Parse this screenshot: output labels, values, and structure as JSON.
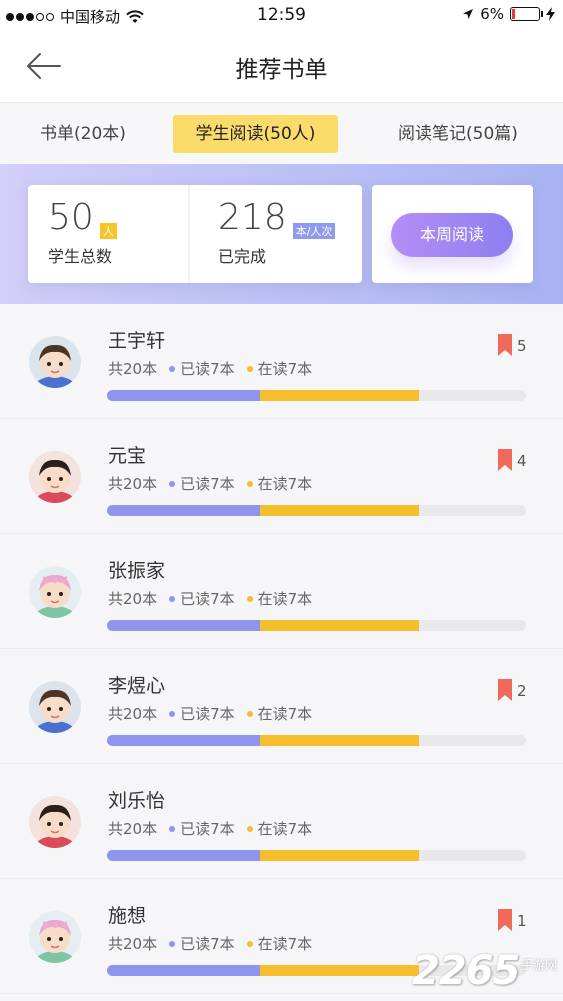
{
  "status_bar": {
    "carrier": "中国移动",
    "time": "12:59",
    "battery": "6%"
  },
  "nav": {
    "title": "推荐书单"
  },
  "tabs": [
    {
      "label": "书单(20本)"
    },
    {
      "label": "学生阅读(50人)"
    },
    {
      "label": "阅读笔记(50篇)"
    }
  ],
  "summary": {
    "students": {
      "value": "50",
      "unit": "人",
      "label": "学生总数"
    },
    "completed": {
      "value": "218",
      "unit": "本/人次",
      "label": "已完成"
    },
    "week_button": "本周阅读"
  },
  "students": [
    {
      "name": "王宇轩",
      "total": "共20本",
      "read": "已读7本",
      "reading": "在读7本",
      "read_fraction": 0.365,
      "reading_fraction": 0.38,
      "bookmarks": "5"
    },
    {
      "name": "元宝",
      "total": "共20本",
      "read": "已读7本",
      "reading": "在读7本",
      "read_fraction": 0.365,
      "reading_fraction": 0.38,
      "bookmarks": "4"
    },
    {
      "name": "张振家",
      "total": "共20本",
      "read": "已读7本",
      "reading": "在读7本",
      "read_fraction": 0.365,
      "reading_fraction": 0.38,
      "bookmarks": ""
    },
    {
      "name": "李煜心",
      "total": "共20本",
      "read": "已读7本",
      "reading": "在读7本",
      "read_fraction": 0.365,
      "reading_fraction": 0.38,
      "bookmarks": "2"
    },
    {
      "name": "刘乐怡",
      "total": "共20本",
      "read": "已读7本",
      "reading": "在读7本",
      "read_fraction": 0.365,
      "reading_fraction": 0.38,
      "bookmarks": ""
    },
    {
      "name": "施想",
      "total": "共20本",
      "read": "已读7本",
      "reading": "在读7本",
      "read_fraction": 0.365,
      "reading_fraction": 0.38,
      "bookmarks": "1"
    }
  ],
  "colors": {
    "accent_yellow": "#fbdc6a",
    "read": "#8f95ec",
    "reading": "#f5be2d",
    "bookmark": "#ef6a5a"
  },
  "watermark": {
    "brand": "2265",
    "sub": "手游网"
  }
}
